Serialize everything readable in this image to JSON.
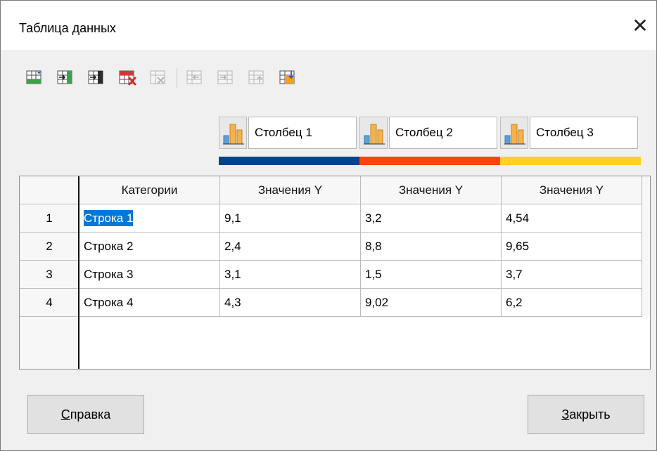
{
  "window": {
    "title": "Таблица данных",
    "close_icon": "close-icon"
  },
  "toolbar": {
    "buttons": [
      {
        "name": "insert-row-icon",
        "enabled": true
      },
      {
        "name": "insert-series-icon",
        "enabled": true
      },
      {
        "name": "insert-text-column-icon",
        "enabled": true
      },
      {
        "name": "delete-row-icon",
        "enabled": true
      },
      {
        "name": "delete-series-icon",
        "enabled": false
      },
      {
        "name": "move-left-icon",
        "enabled": false
      },
      {
        "name": "move-right-icon",
        "enabled": false
      },
      {
        "name": "move-up-icon",
        "enabled": false
      },
      {
        "name": "move-down-icon",
        "enabled": true
      }
    ]
  },
  "series": [
    {
      "name": "Столбец 1",
      "color": "#004586"
    },
    {
      "name": "Столбец 2",
      "color": "#ff420e"
    },
    {
      "name": "Столбец 3",
      "color": "#ffd320"
    }
  ],
  "table": {
    "headers": [
      "Категории",
      "Значения Y",
      "Значения Y",
      "Значения Y"
    ],
    "rows": [
      {
        "num": "1",
        "category": "Строка 1",
        "values": [
          "9,1",
          "3,2",
          "4,54"
        ]
      },
      {
        "num": "2",
        "category": "Строка 2",
        "values": [
          "2,4",
          "8,8",
          "9,65"
        ]
      },
      {
        "num": "3",
        "category": "Строка 3",
        "values": [
          "3,1",
          "1,5",
          "3,7"
        ]
      },
      {
        "num": "4",
        "category": "Строка 4",
        "values": [
          "4,3",
          "9,02",
          "6,2"
        ]
      }
    ]
  },
  "buttons": {
    "help_mnemonic": "С",
    "help_rest": "правка",
    "close_mnemonic": "З",
    "close_rest": "акрыть"
  },
  "colors": {
    "selection": "#0078d7"
  }
}
